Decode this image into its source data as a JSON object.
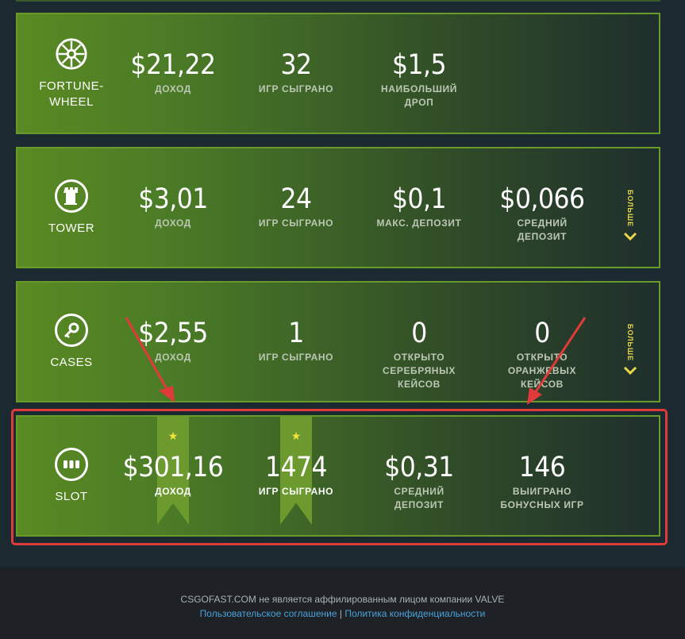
{
  "cards": [
    {
      "game": "FORTUNE-\nWHEEL",
      "stats": [
        {
          "value": "$21,22",
          "label": "ДОХОД"
        },
        {
          "value": "32",
          "label": "ИГР СЫГРАНО"
        },
        {
          "value": "$1,5",
          "label": "НАИБОЛЬШИЙ ДРОП"
        }
      ]
    },
    {
      "game": "TOWER",
      "stats": [
        {
          "value": "$3,01",
          "label": "ДОХОД"
        },
        {
          "value": "24",
          "label": "ИГР СЫГРАНО"
        },
        {
          "value": "$0,1",
          "label": "МАКС. ДЕПОЗИТ"
        },
        {
          "value": "$0,066",
          "label": "СРЕДНИЙ ДЕПОЗИТ"
        }
      ],
      "more": "БОЛЬШЕ"
    },
    {
      "game": "CASES",
      "stats": [
        {
          "value": "$2,55",
          "label": "ДОХОД"
        },
        {
          "value": "1",
          "label": "ИГР СЫГРАНО"
        },
        {
          "value": "0",
          "label": "ОТКРЫТО СЕРЕБРЯНЫХ КЕЙСОВ"
        },
        {
          "value": "0",
          "label": "ОТКРЫТО ОРАНЖЕВЫХ КЕЙСОВ"
        }
      ],
      "more": "БОЛЬШЕ"
    },
    {
      "game": "SLOT",
      "stats": [
        {
          "value": "$301,16",
          "label": "ДОХОД"
        },
        {
          "value": "1474",
          "label": "ИГР СЫГРАНО"
        },
        {
          "value": "$0,31",
          "label": "СРЕДНИЙ ДЕПОЗИТ"
        },
        {
          "value": "146",
          "label": "ВЫИГРАНО БОНУСНЫХ ИГР"
        }
      ]
    }
  ],
  "footer": {
    "disclaimer": "CSGOFAST.COM не является аффилированным лицом компании VALVE",
    "terms_link": "Пользовательское соглашение",
    "separator": "|",
    "privacy_link": "Политика конфиденциальности"
  },
  "colors": {
    "highlight_border": "#e03a3a",
    "more_accent": "#e8d84a",
    "link": "#4aa3d8"
  }
}
